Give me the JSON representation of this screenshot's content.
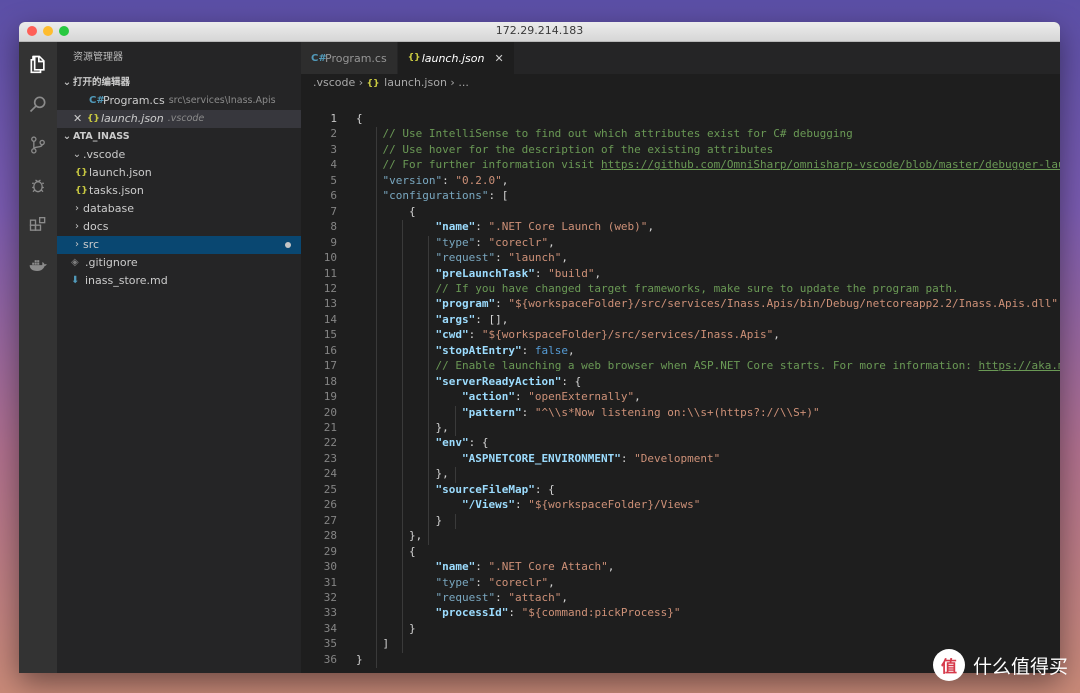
{
  "window": {
    "title": "172.29.214.183"
  },
  "sidebar": {
    "title": "资源管理器",
    "open_editors": {
      "header": "打开的编辑器",
      "items": [
        {
          "name": "Program.cs",
          "path": "src\\services\\Inass.Apis"
        },
        {
          "name": "launch.json",
          "path": ".vscode"
        }
      ]
    },
    "project": {
      "header": "ATA_INASS",
      "items": [
        ".vscode",
        "launch.json",
        "tasks.json",
        "database",
        "docs",
        "src",
        ".gitignore",
        "inass_store.md"
      ]
    }
  },
  "tabs": [
    {
      "label": "Program.cs"
    },
    {
      "label": "launch.json"
    }
  ],
  "breadcrumb": [
    ".vscode",
    "launch.json",
    "..."
  ],
  "editor": {
    "line_numbers": [
      "1",
      "2",
      "3",
      "4",
      "5",
      "6",
      "7",
      "8",
      "9",
      "10",
      "11",
      "12",
      "13",
      "14",
      "15",
      "16",
      "17",
      "18",
      "19",
      "20",
      "21",
      "22",
      "23",
      "24",
      "25",
      "26",
      "27",
      "28",
      "29",
      "30",
      "31",
      "32",
      "33",
      "34",
      "35",
      "36"
    ],
    "lines": [
      [
        [
          "p",
          "{"
        ]
      ],
      [
        [
          "p",
          "    "
        ],
        [
          "c",
          "// Use IntelliSense to find out which attributes exist for C# debugging"
        ]
      ],
      [
        [
          "p",
          "    "
        ],
        [
          "c",
          "// Use hover for the description of the existing attributes"
        ]
      ],
      [
        [
          "p",
          "    "
        ],
        [
          "c",
          "// For further information visit "
        ],
        [
          "u",
          "https://github.com/OmniSharp/omnisharp-vscode/blob/master/debugger-launchjson.md"
        ]
      ],
      [
        [
          "p",
          "    "
        ],
        [
          "kd",
          "\"version\""
        ],
        [
          "p",
          ": "
        ],
        [
          "s",
          "\"0.2.0\""
        ],
        [
          "p",
          ","
        ]
      ],
      [
        [
          "p",
          "    "
        ],
        [
          "kd",
          "\"configurations\""
        ],
        [
          "p",
          ": ["
        ]
      ],
      [
        [
          "p",
          "        {"
        ]
      ],
      [
        [
          "p",
          "            "
        ],
        [
          "kb",
          "\"name\""
        ],
        [
          "p",
          ": "
        ],
        [
          "s",
          "\".NET Core Launch (web)\""
        ],
        [
          "p",
          ","
        ]
      ],
      [
        [
          "p",
          "            "
        ],
        [
          "kd",
          "\"type\""
        ],
        [
          "p",
          ": "
        ],
        [
          "s",
          "\"coreclr\""
        ],
        [
          "p",
          ","
        ]
      ],
      [
        [
          "p",
          "            "
        ],
        [
          "kd",
          "\"request\""
        ],
        [
          "p",
          ": "
        ],
        [
          "s",
          "\"launch\""
        ],
        [
          "p",
          ","
        ]
      ],
      [
        [
          "p",
          "            "
        ],
        [
          "kb",
          "\"preLaunchTask\""
        ],
        [
          "p",
          ": "
        ],
        [
          "s",
          "\"build\""
        ],
        [
          "p",
          ","
        ]
      ],
      [
        [
          "p",
          "            "
        ],
        [
          "c",
          "// If you have changed target frameworks, make sure to update the program path."
        ]
      ],
      [
        [
          "p",
          "            "
        ],
        [
          "kb",
          "\"program\""
        ],
        [
          "p",
          ": "
        ],
        [
          "s",
          "\"${workspaceFolder}/src/services/Inass.Apis/bin/Debug/netcoreapp2.2/Inass.Apis.dll\""
        ],
        [
          "p",
          ","
        ]
      ],
      [
        [
          "p",
          "            "
        ],
        [
          "kb",
          "\"args\""
        ],
        [
          "p",
          ": [],"
        ]
      ],
      [
        [
          "p",
          "            "
        ],
        [
          "kb",
          "\"cwd\""
        ],
        [
          "p",
          ": "
        ],
        [
          "s",
          "\"${workspaceFolder}/src/services/Inass.Apis\""
        ],
        [
          "p",
          ","
        ]
      ],
      [
        [
          "p",
          "            "
        ],
        [
          "kb",
          "\"stopAtEntry\""
        ],
        [
          "p",
          ": "
        ],
        [
          "b",
          "false"
        ],
        [
          "p",
          ","
        ]
      ],
      [
        [
          "p",
          "            "
        ],
        [
          "c",
          "// Enable launching a web browser when ASP.NET Core starts. For more information: "
        ],
        [
          "u",
          "https://aka.ms/VSCode-CS-LaunchJson-WebBrowser"
        ]
      ],
      [
        [
          "p",
          "            "
        ],
        [
          "kb",
          "\"serverReadyAction\""
        ],
        [
          "p",
          ": {"
        ]
      ],
      [
        [
          "p",
          "                "
        ],
        [
          "kb",
          "\"action\""
        ],
        [
          "p",
          ": "
        ],
        [
          "s",
          "\"openExternally\""
        ],
        [
          "p",
          ","
        ]
      ],
      [
        [
          "p",
          "                "
        ],
        [
          "kb",
          "\"pattern\""
        ],
        [
          "p",
          ": "
        ],
        [
          "s",
          "\"^\\\\s*Now listening on:\\\\s+(https?://\\\\S+)\""
        ]
      ],
      [
        [
          "p",
          "            },"
        ]
      ],
      [
        [
          "p",
          "            "
        ],
        [
          "kb",
          "\"env\""
        ],
        [
          "p",
          ": {"
        ]
      ],
      [
        [
          "p",
          "                "
        ],
        [
          "kb",
          "\"ASPNETCORE_ENVIRONMENT\""
        ],
        [
          "p",
          ": "
        ],
        [
          "s",
          "\"Development\""
        ]
      ],
      [
        [
          "p",
          "            },"
        ]
      ],
      [
        [
          "p",
          "            "
        ],
        [
          "kb",
          "\"sourceFileMap\""
        ],
        [
          "p",
          ": {"
        ]
      ],
      [
        [
          "p",
          "                "
        ],
        [
          "kb",
          "\"/Views\""
        ],
        [
          "p",
          ": "
        ],
        [
          "s",
          "\"${workspaceFolder}/Views\""
        ]
      ],
      [
        [
          "p",
          "            }"
        ]
      ],
      [
        [
          "p",
          "        },"
        ]
      ],
      [
        [
          "p",
          "        {"
        ]
      ],
      [
        [
          "p",
          "            "
        ],
        [
          "kb",
          "\"name\""
        ],
        [
          "p",
          ": "
        ],
        [
          "s",
          "\".NET Core Attach\""
        ],
        [
          "p",
          ","
        ]
      ],
      [
        [
          "p",
          "            "
        ],
        [
          "kd",
          "\"type\""
        ],
        [
          "p",
          ": "
        ],
        [
          "s",
          "\"coreclr\""
        ],
        [
          "p",
          ","
        ]
      ],
      [
        [
          "p",
          "            "
        ],
        [
          "kd",
          "\"request\""
        ],
        [
          "p",
          ": "
        ],
        [
          "s",
          "\"attach\""
        ],
        [
          "p",
          ","
        ]
      ],
      [
        [
          "p",
          "            "
        ],
        [
          "kb",
          "\"processId\""
        ],
        [
          "p",
          ": "
        ],
        [
          "s",
          "\"${command:pickProcess}\""
        ]
      ],
      [
        [
          "p",
          "        }"
        ]
      ],
      [
        [
          "p",
          "    ]"
        ]
      ],
      [
        [
          "p",
          "}"
        ]
      ]
    ]
  },
  "watermark": {
    "logo_char": "值",
    "text": "什么值得买"
  },
  "colors": {
    "accent": "#094771",
    "activity_bar": "#333333",
    "sidebar": "#252526",
    "editor_bg": "#1e1e1e"
  }
}
